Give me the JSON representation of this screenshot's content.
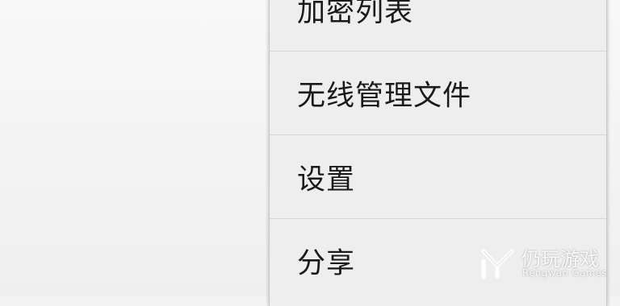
{
  "menu": {
    "items": [
      {
        "label": "加密列表"
      },
      {
        "label": "无线管理文件"
      },
      {
        "label": "设置"
      },
      {
        "label": "分享"
      }
    ]
  },
  "watermark": {
    "title": "仍玩游戏",
    "subtitle": "Rengwan Games"
  }
}
